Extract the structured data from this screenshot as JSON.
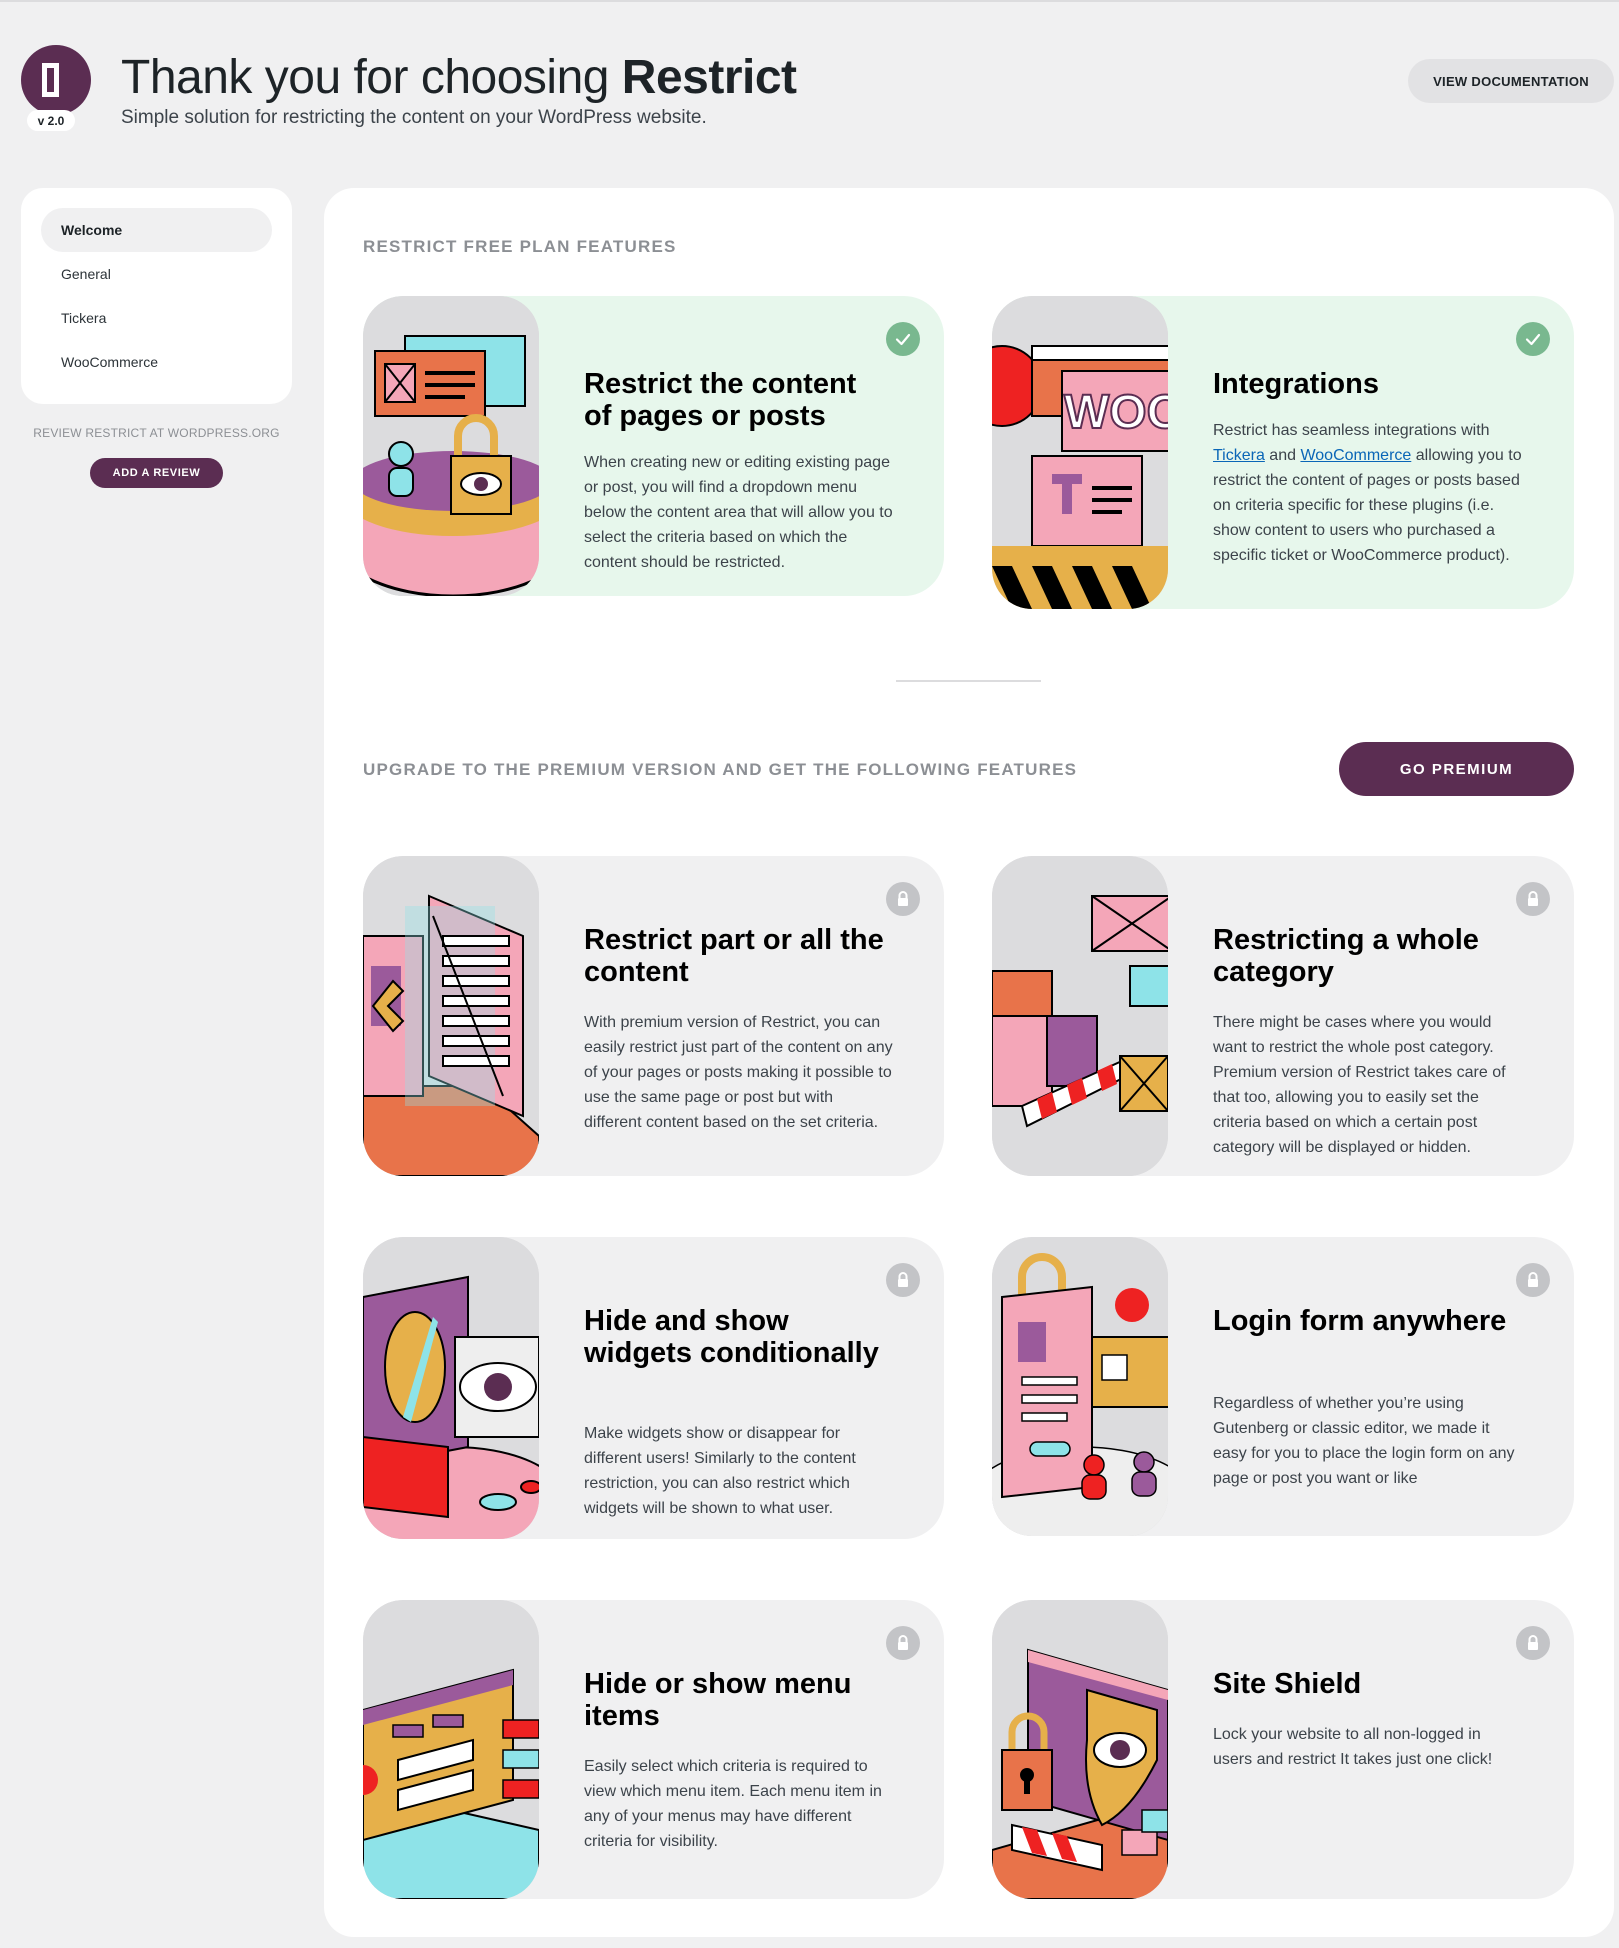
{
  "header": {
    "version": "v 2.0",
    "title_prefix": "Thank you for choosing ",
    "title_brand": "Restrict",
    "subtitle": "Simple solution for restricting the content on your WordPress website.",
    "doc_button": "VIEW DOCUMENTATION"
  },
  "sidebar": {
    "items": [
      {
        "label": "Welcome",
        "active": true
      },
      {
        "label": "General"
      },
      {
        "label": "Tickera"
      },
      {
        "label": "WooCommerce"
      }
    ],
    "review_text": "REVIEW RESTRICT AT WORDPRESS.ORG",
    "review_button": "ADD A REVIEW"
  },
  "free": {
    "label": "RESTRICT FREE PLAN FEATURES",
    "cards": [
      {
        "title": "Restrict the content of pages or posts",
        "text": "When creating new or editing existing page or post, you will find a dropdown menu below the content area that will allow you to select the criteria based on which the content should be restricted."
      },
      {
        "title": "Integrations",
        "text_before": "Restrict has seamless integrations with ",
        "link1": "Tickera",
        "text_mid": " and ",
        "link2": "WooCommerce",
        "text_after": " allowing you to restrict the content of pages or posts based on criteria specific for these plugins (i.e. show content to users who purchased a specific ticket or WooCommerce product).",
        "illus_text": "WOO"
      }
    ]
  },
  "premium": {
    "label": "UPGRADE TO THE PREMIUM VERSION AND GET THE FOLLOWING FEATURES",
    "button": "GO PREMIUM",
    "cards": [
      {
        "title": "Restrict part or all the content",
        "text": "With premium version of Restrict, you can easily restrict just part of the content on any of your pages or posts making it possible to use the same page or post but with different content based on the set criteria."
      },
      {
        "title": "Restricting a whole category",
        "text": "There might be cases where you would want to restrict the whole post category. Premium version of Restrict takes care of that too, allowing you to easily set the criteria based on which a certain post category will be displayed or hidden."
      },
      {
        "title": "Hide and show widgets conditionally",
        "text": "Make widgets show or disappear for different users! Similarly to the content restriction, you can also restrict which widgets will be shown to what user."
      },
      {
        "title": "Login form anywhere",
        "text": "Regardless of whether you’re using Gutenberg or classic editor, we made it easy for you to place the login form on any page or post you want or like"
      },
      {
        "title": "Hide or show menu items",
        "text": "Easily select which criteria is required to view which menu item. Each menu item in any of your menus may have different criteria for visibility."
      },
      {
        "title": "Site Shield",
        "text": "Lock your website to all non-logged in users and restrict It takes just one click!"
      }
    ]
  },
  "colors": {
    "brand": "#5b2d52",
    "free_card_bg": "#e7f7ec",
    "premium_card_bg": "#f0f0f1",
    "check_badge": "#79b88f",
    "lock_badge": "#c3c4c7"
  }
}
